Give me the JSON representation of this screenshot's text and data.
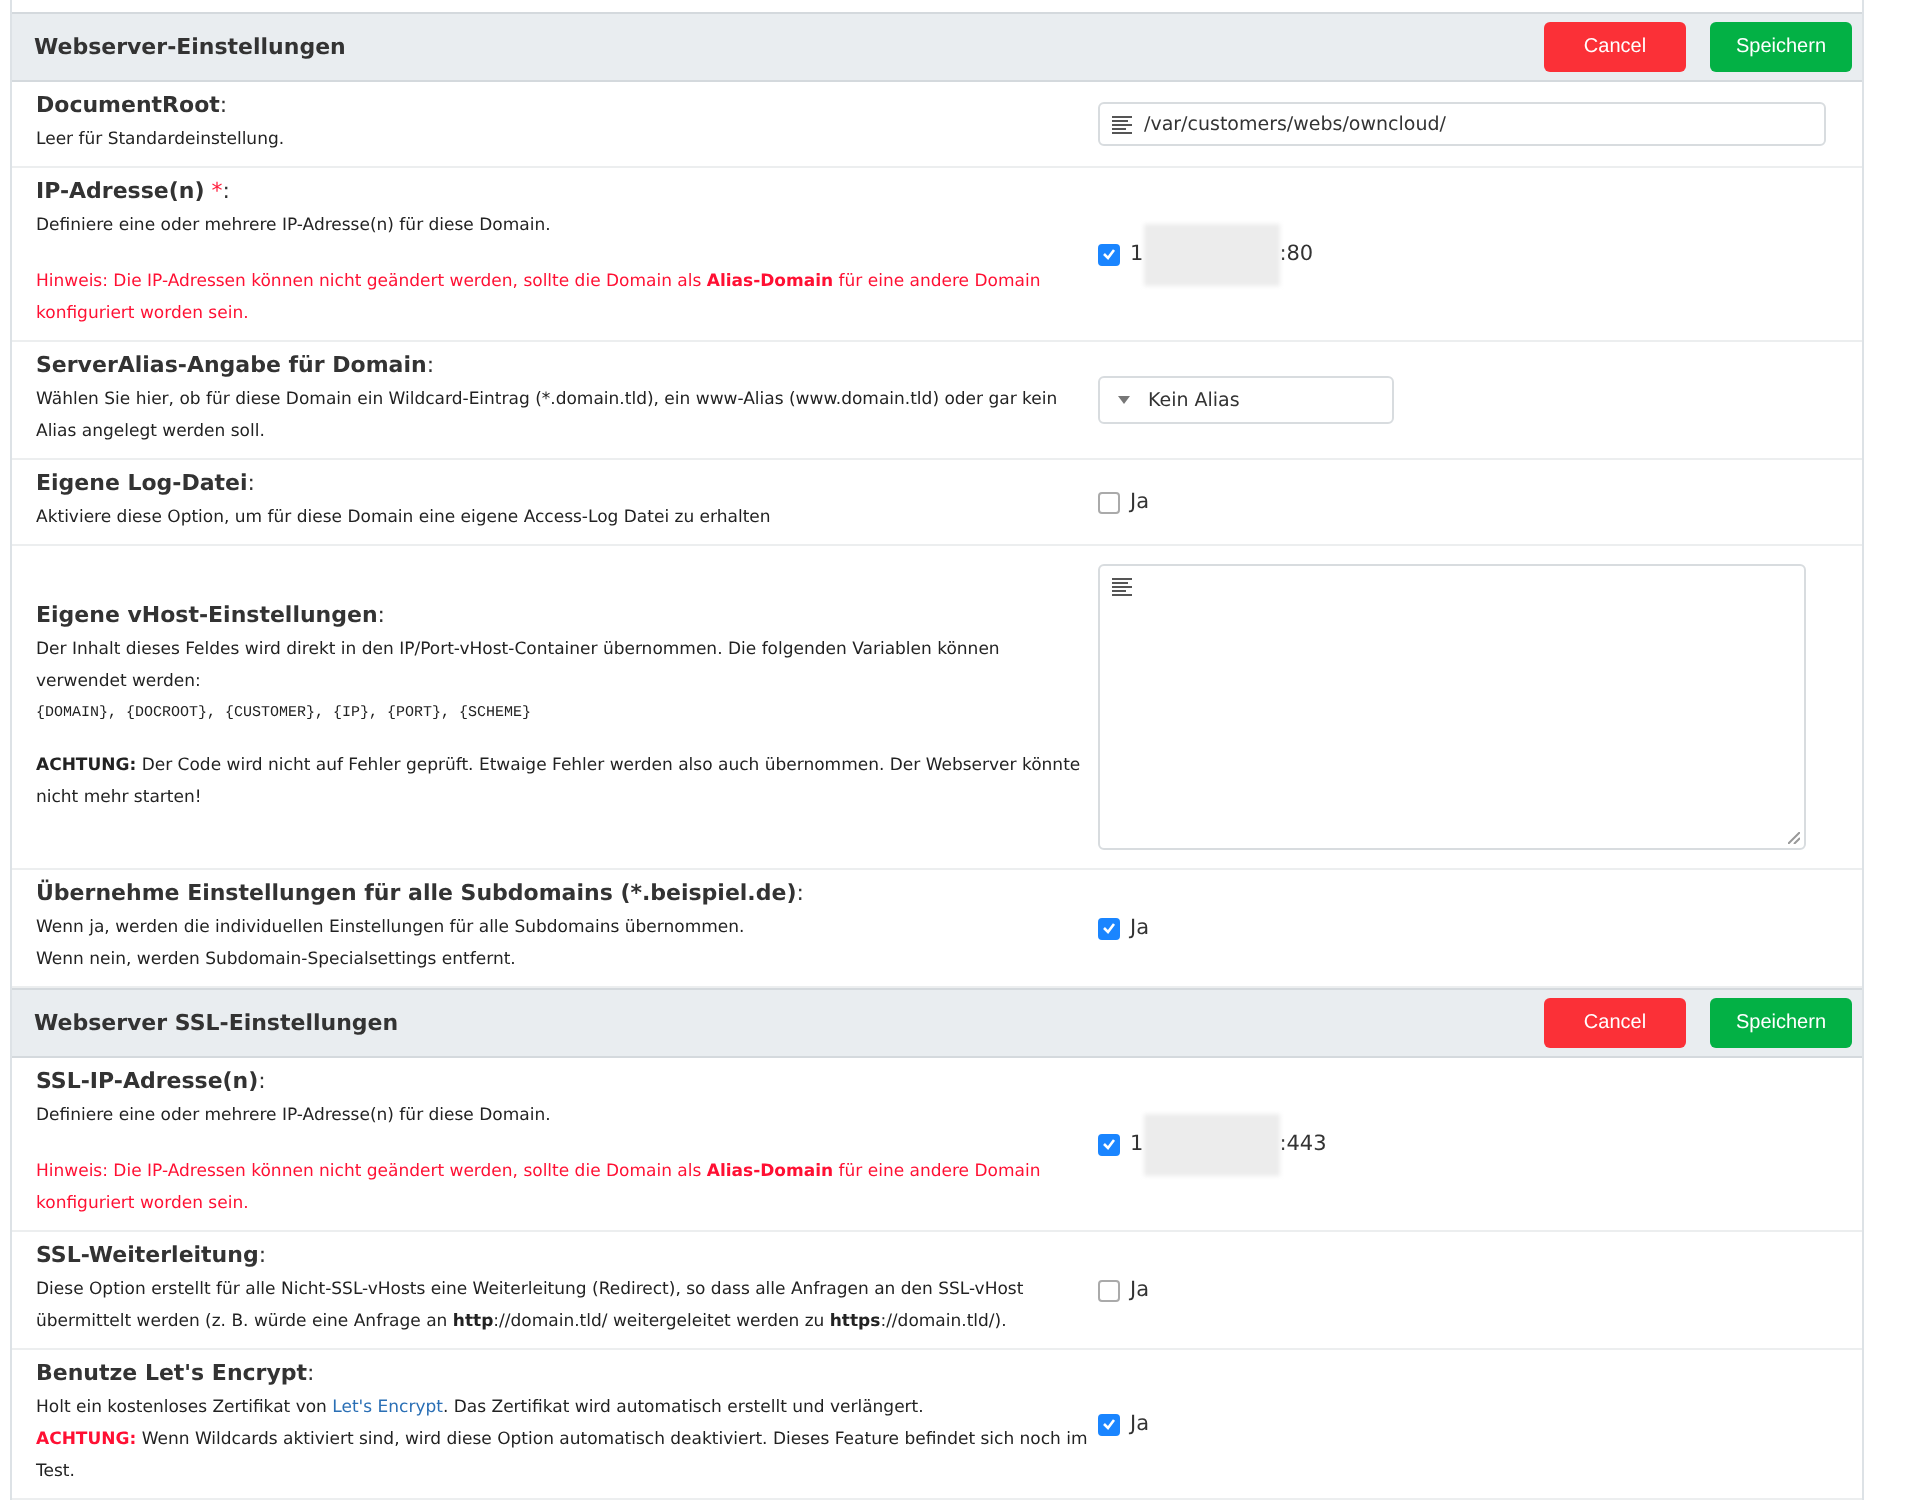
{
  "sections": [
    {
      "title": "Webserver-Einstellungen",
      "buttons": [
        {
          "label": "Cancel",
          "kind": "danger"
        },
        {
          "label": "Speichern",
          "kind": "success"
        }
      ],
      "rows": [
        {
          "label": "**DocumentRoot**:",
          "paragraphs": [
            {
              "kind": "plain",
              "text": "Leer für Standardeinstellung."
            }
          ],
          "control": {
            "kind": "text",
            "value": "/var/customers/webs/owncloud/"
          }
        },
        {
          "label": "**IP-Adresse(n)** ",
          "required_mark": "*",
          "label_end": ":",
          "paragraphs": [
            {
              "kind": "plain",
              "text": "Definiere eine oder mehrere IP-Adresse(n) für diese Domain."
            },
            {
              "kind": "note",
              "text": "Hinweis: Die IP-Adressen können nicht geändert werden, sollte die Domain als **Alias-Domain** für eine andere Domain konfiguriert worden sein."
            }
          ],
          "control": {
            "kind": "ip",
            "checked": true,
            "prefix": "1",
            "suffix": ":80"
          }
        },
        {
          "label": "**ServerAlias-Angabe für Domain**:",
          "paragraphs": [
            {
              "kind": "plain",
              "text": "Wählen Sie hier, ob für diese Domain ein Wildcard-Eintrag (*.domain.tld), ein www-Alias (www.domain.tld) oder gar kein Alias angelegt werden soll."
            }
          ],
          "control": {
            "kind": "select",
            "value": "Kein Alias"
          }
        },
        {
          "label": "**Eigene Log-Datei**:",
          "paragraphs": [
            {
              "kind": "plain",
              "text": "Aktiviere diese Option, um für diese Domain eine eigene Access-Log Datei zu erhalten"
            }
          ],
          "control": {
            "kind": "checkbox",
            "checked": false,
            "label": "Ja"
          }
        },
        {
          "label": "**Eigene vHost-Einstellungen**:",
          "paragraphs": [
            {
              "kind": "plain",
              "text": "Der Inhalt dieses Feldes wird direkt in den IP/Port-vHost-Container übernommen. Die folgenden Variablen können verwendet werden:"
            },
            {
              "kind": "code",
              "text": "{DOMAIN}, {DOCROOT}, {CUSTOMER}, {IP}, {PORT}, {SCHEME}"
            },
            {
              "kind": "plain",
              "text": "**ACHTUNG:** Der Code wird nicht auf Fehler geprüft. Etwaige Fehler werden also auch übernommen. Der Webserver könnte nicht mehr starten!"
            }
          ],
          "control": {
            "kind": "textarea"
          }
        },
        {
          "label": "**Übernehme Einstellungen für alle Subdomains (*.beispiel.de)**:",
          "paragraphs": [
            {
              "kind": "plain",
              "text": "Wenn ja, werden die individuellen Einstellungen für alle Subdomains übernommen."
            },
            {
              "kind": "line",
              "text": "Wenn nein, werden Subdomain-Specialsettings entfernt."
            }
          ],
          "control": {
            "kind": "checkbox",
            "checked": true,
            "label": "Ja"
          }
        }
      ]
    },
    {
      "title": "Webserver SSL-Einstellungen",
      "buttons": [
        {
          "label": "Cancel",
          "kind": "danger"
        },
        {
          "label": "Speichern",
          "kind": "success"
        }
      ],
      "rows": [
        {
          "label": "**SSL-IP-Adresse(n)**:",
          "paragraphs": [
            {
              "kind": "plain",
              "text": "Definiere eine oder mehrere IP-Adresse(n) für diese Domain."
            },
            {
              "kind": "note",
              "text": "Hinweis: Die IP-Adressen können nicht geändert werden, sollte die Domain als **Alias-Domain** für eine andere Domain konfiguriert worden sein."
            }
          ],
          "control": {
            "kind": "ip",
            "checked": true,
            "prefix": "1",
            "suffix": ":443"
          }
        },
        {
          "label": "**SSL-Weiterleitung**:",
          "paragraphs": [
            {
              "kind": "plain",
              "text": "Diese Option erstellt für alle Nicht-SSL-vHosts eine Weiterleitung (Redirect), so dass alle Anfragen an den SSL-vHost übermittelt werden (z. B. würde eine Anfrage an **http**://domain.tld/ weitergeleitet werden zu **https**://domain.tld/)."
            }
          ],
          "control": {
            "kind": "checkbox",
            "checked": false,
            "label": "Ja"
          }
        },
        {
          "label": "**Benutze Let's Encrypt**:",
          "paragraphs": [
            {
              "kind": "plain",
              "text": "Holt ein kostenloses Zertifikat von ",
              "link": "Let's Encrypt",
              "text_after": ". Das Zertifikat wird automatisch erstellt und verlängert."
            },
            {
              "kind": "warning",
              "text": "**ACHTUNG:** Wenn Wildcards aktiviert sind, wird diese Option automatisch deaktiviert. Dieses Feature befindet sich noch im Test."
            }
          ],
          "control": {
            "kind": "checkbox",
            "checked": true,
            "label": "Ja"
          }
        }
      ]
    }
  ]
}
